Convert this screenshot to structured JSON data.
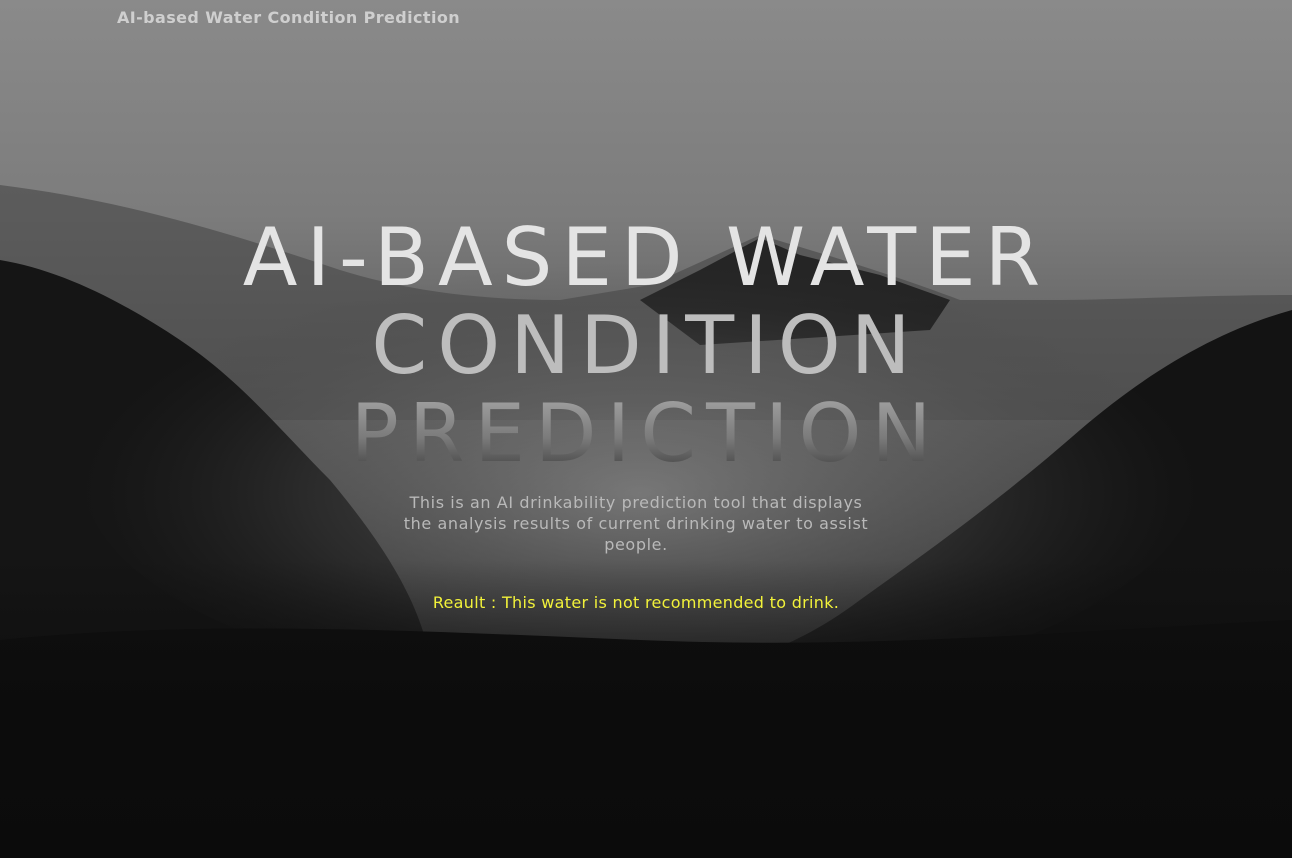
{
  "header": {
    "brand": "AI-based Water Condition Prediction"
  },
  "hero": {
    "title_lines": [
      "AI-BASED WATER",
      "CONDITION",
      "PREDICTION"
    ],
    "description": "This is an AI drinkability prediction tool that displays the analysis results of current drinking water to assist people.",
    "result_label": "Reault : ",
    "result_value": "This water is not recommended to drink.",
    "result_color": "#f2f23a"
  },
  "background": {
    "scene": "foggy-mountain-forest-grayscale"
  }
}
